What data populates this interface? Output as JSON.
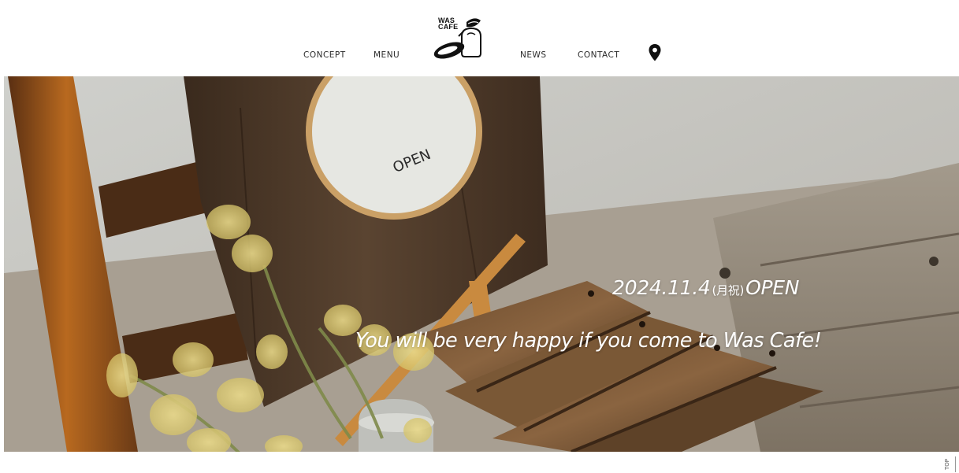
{
  "nav": {
    "concept": "CONCEPT",
    "menu": "MENU",
    "news": "NEWS",
    "contact": "CONTACT"
  },
  "logo": {
    "line1": "WAS",
    "line2": "CAFE"
  },
  "hero": {
    "sign_text": "OPEN",
    "date": "2024.11.4",
    "holiday": "(月祝)",
    "open": "OPEN",
    "tagline": "You will be very happy if you come to Was Cafe!"
  },
  "to_top": "TOP",
  "icons": {
    "location": "map-pin-icon"
  },
  "colors": {
    "background": "#ffffff",
    "nav_text": "#2b2b2b",
    "hero_text": "#ffffff"
  }
}
